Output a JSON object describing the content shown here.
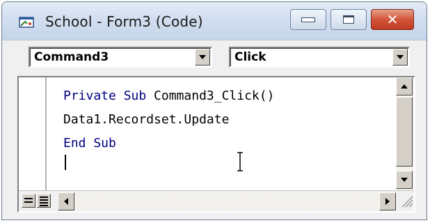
{
  "window": {
    "title": "School - Form3 (Code)",
    "icons": {
      "app": "vb-code-window-icon",
      "minimize": "minimize-icon",
      "maximize": "maximize-icon",
      "close": "close-icon"
    },
    "close_color": "#c0391f"
  },
  "combos": {
    "object": {
      "value": "Command3"
    },
    "procedure": {
      "value": "Click"
    }
  },
  "editor": {
    "keyword_color": "#00007f",
    "lines": [
      {
        "kw1": "Private Sub",
        "rest": " Command3_Click()"
      },
      {
        "rest": "Data1.Recordset.Update"
      },
      {
        "kw1": "End Sub"
      }
    ]
  },
  "footer": {
    "procedure_view": "procedure-view-icon",
    "full_module_view": "full-module-view-icon"
  }
}
